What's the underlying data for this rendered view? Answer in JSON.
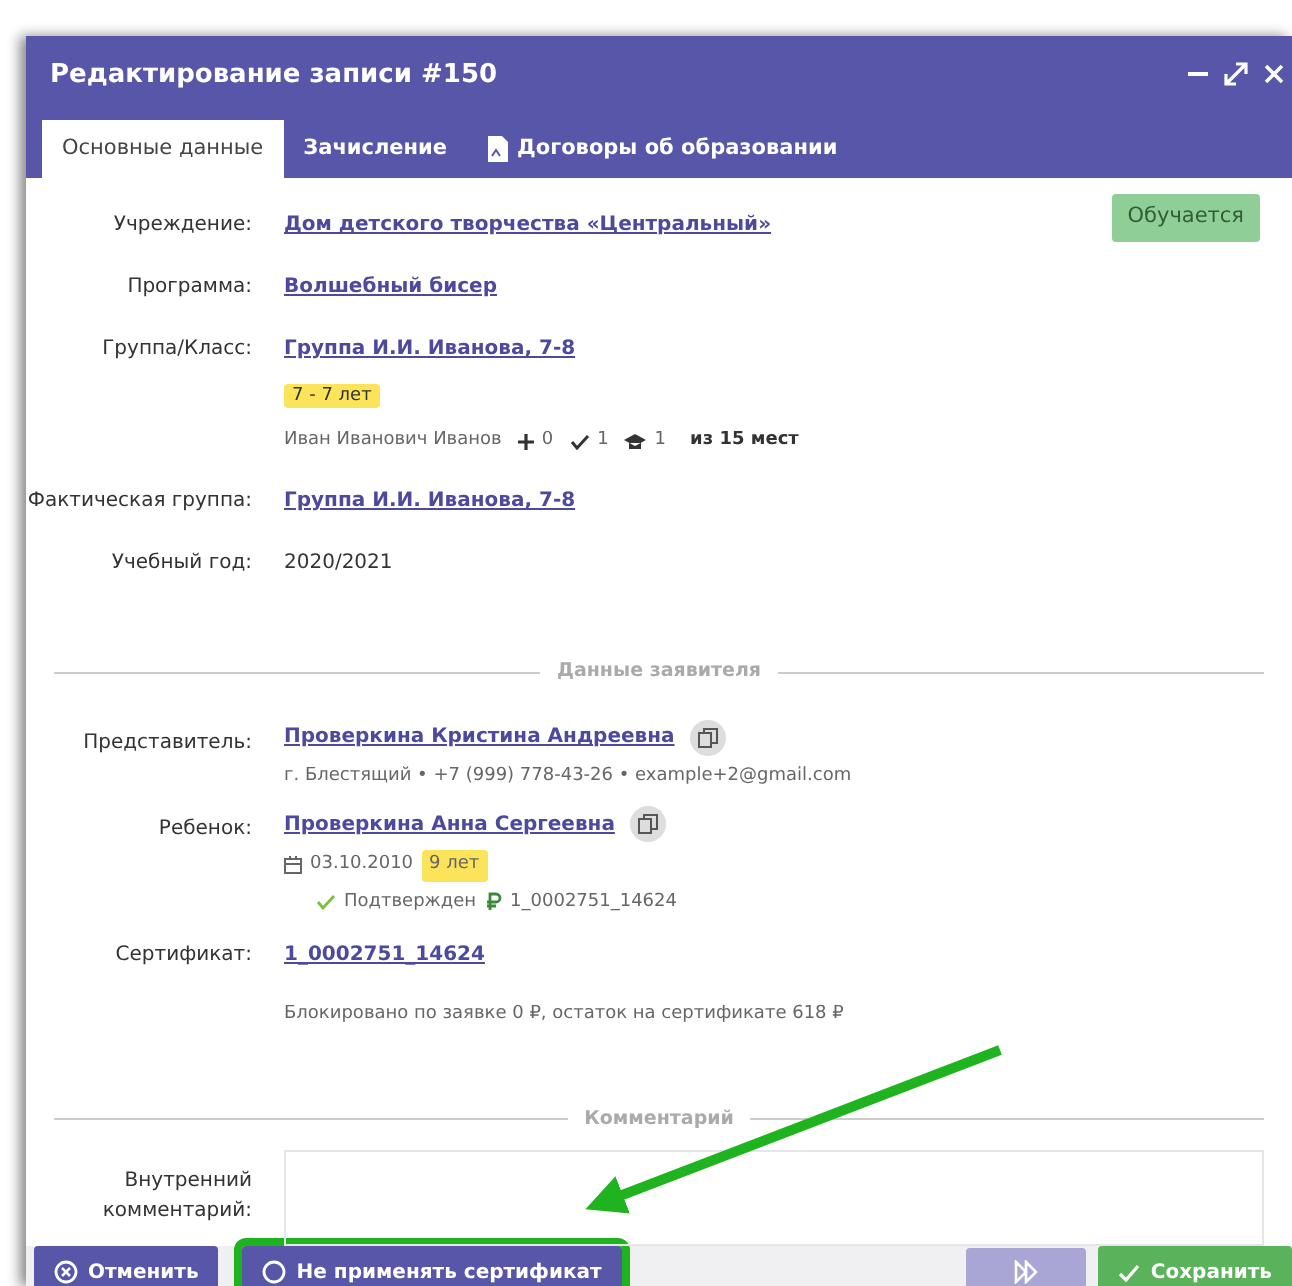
{
  "window": {
    "title": "Редактирование записи #150"
  },
  "tabs": [
    {
      "label": "Основные данные",
      "selected": true,
      "kind": "plain"
    },
    {
      "label": "Зачисление",
      "selected": false,
      "kind": "plain"
    },
    {
      "label": "Договоры об образовании",
      "selected": false,
      "kind": "document"
    }
  ],
  "status_badge": "Обучается",
  "fields": [
    {
      "kind": "link",
      "label": "Учреждение:",
      "value": "Дом детского творчества «Центральный»"
    },
    {
      "kind": "link",
      "label": "Программа:",
      "value": "Волшебный бисер"
    },
    {
      "kind": "group",
      "label": "Группа/Класс:",
      "value": "Группа И.И. Иванова, 7-8",
      "age": "7 - 7 лет",
      "teacher": "Иван Иванович Иванов",
      "added": "0",
      "confirmed": "1",
      "students": "1",
      "capacity": "из 15 мест"
    },
    {
      "kind": "link",
      "label": "Фактическая группа:",
      "value": "Группа И.И. Иванова, 7-8"
    },
    {
      "kind": "text",
      "label": "Учебный год:",
      "value": "2020/2021"
    }
  ],
  "applicant": {
    "title": "Данные заявителя",
    "representative": {
      "label": "Представитель:",
      "name": "Проверкина Кристина Андреевна",
      "contacts": "г. Блестящий • +7 (999) 778-43-26 • example+2@gmail.com"
    },
    "child": {
      "label": "Ребенок:",
      "name": "Проверкина Анна Сергеевна",
      "birth_date": "03.10.2010",
      "age": "9 лет",
      "status": "Подтвержден",
      "certificate": "1_0002751_14624"
    },
    "certificate": {
      "label": "Сертификат:",
      "number": "1_0002751_14624",
      "note": "Блокировано по заявке 0 ₽, остаток на сертификате 618 ₽"
    }
  },
  "comment": {
    "title": "Комментарий",
    "label": "Внутренний комментарий:"
  },
  "footer": [
    {
      "kind": "cancel",
      "label": "Отменить",
      "disabled": false,
      "highlighted": false
    },
    {
      "kind": "no-cert",
      "label": "Не применять сертификат",
      "disabled": false,
      "highlighted": true
    },
    {
      "kind": "next",
      "disabled": true,
      "highlighted": false
    },
    {
      "kind": "save",
      "label": "Сохранить",
      "disabled": false,
      "highlighted": false
    }
  ]
}
